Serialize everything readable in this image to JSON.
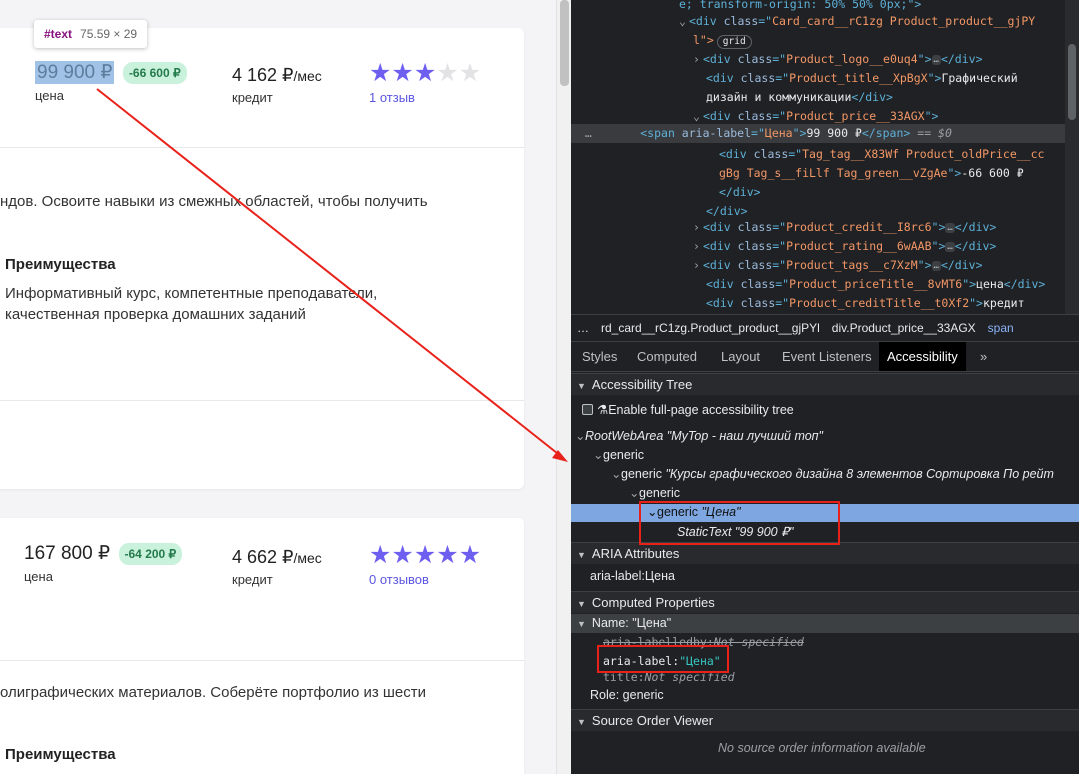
{
  "tooltip": {
    "node": "#text",
    "size": "75.59 × 29"
  },
  "cards": [
    {
      "price": "99 900 ₽",
      "old_price_tag": "-66 600 ₽",
      "price_caption": "цена",
      "credit": "4 162 ₽",
      "credit_unit": "/мес",
      "credit_caption": "кредит",
      "rating": 3,
      "rating_max": 5,
      "reviews": "1 отзыв",
      "description": "ндов. Освоите навыки из смежных областей, чтобы получить",
      "advantages_title": "Преимущества",
      "advantages_line1": "Информативный курс, компетентные преподаватели,",
      "advantages_line2": "качественная проверка домашних заданий"
    },
    {
      "price": "167 800 ₽",
      "old_price_tag": "-64 200 ₽",
      "price_caption": "цена",
      "credit": "4 662 ₽",
      "credit_unit": "/мес",
      "credit_caption": "кредит",
      "rating": 5,
      "rating_max": 5,
      "reviews": "0 отзывов",
      "description": "олиграфических материалов. Соберёте портфолио из шести",
      "advantages_title": "Преимущества"
    }
  ],
  "elements_panel": {
    "line0": "e; transform-origin: 50% 50% 0px;\">",
    "card_class": "Card_card__rC1zg Product_product__gjPY",
    "card_class_cont": "l\">",
    "grid_badge": "grid",
    "logo_class": "Product_logo__e0uq4",
    "title_class": "Product_title__XpBgX",
    "title_text1": "Графический",
    "title_text2": "дизайн и коммуникации",
    "price_class": "Product_price__33AGX",
    "span_aria": "Цена",
    "span_text": "99 900 ₽",
    "eq_ref": "== $0",
    "tag_class1": "Tag_tag__X83Wf Product_oldPrice__cc",
    "tag_class2": "gBg Tag_s__fiLlf Tag_green__vZgAe",
    "tag_text": "-66 600 ₽",
    "credit_class": "Product_credit__I8rc6",
    "rating_class": "Product_rating__6wAAB",
    "tags_class": "Product_tags__c7XzM",
    "price_title_class": "Product_priceTitle__8vMT6",
    "price_title_text": "цена",
    "credit_title_class": "Product_creditTitle__t0Xf2",
    "credit_title_text": "кредит"
  },
  "breadcrumbs": [
    "…",
    "rd_card__rC1zg.Product_product__gjPYl",
    "div.Product_price__33AGX",
    "span"
  ],
  "tabs": [
    "Styles",
    "Computed",
    "Layout",
    "Event Listeners",
    "Accessibility",
    "»"
  ],
  "active_tab": "Accessibility",
  "accessibility": {
    "tree_header": "Accessibility Tree",
    "enable_label": "Enable full-page accessibility tree",
    "root_role": "RootWebArea",
    "root_name": "\"MyTop - наш лучший топ\"",
    "generic1": "generic",
    "generic2_role": "generic",
    "generic2_name": "\"Курсы графического дизайна 8 элементов Сортировка По рейт",
    "generic3": "generic",
    "generic_sel_role": "generic",
    "generic_sel_name": "\"Цена\"",
    "static_role": "StaticText",
    "static_name": "\"99 900 ₽\"",
    "aria_header": "ARIA Attributes",
    "aria_label_name": "aria-label",
    "aria_label_value": "Цена",
    "computed_header": "Computed Properties",
    "name_row": "Name: \"Цена\"",
    "labelledby_name": "aria-labelledby",
    "labelledby_value": "Not specified",
    "cp_aria_name": "aria-label",
    "cp_aria_value": "\"Цена\"",
    "title_name": "title",
    "title_value": "Not specified",
    "role_label": "Role",
    "role_value": "generic",
    "source_header": "Source Order Viewer",
    "source_note": "No source order information available"
  },
  "colors": {
    "accent_red": "#e8221b",
    "star": "#6e5ff0",
    "tag_green_bg": "#c9f1dc",
    "selection": "#7ea6e0"
  }
}
